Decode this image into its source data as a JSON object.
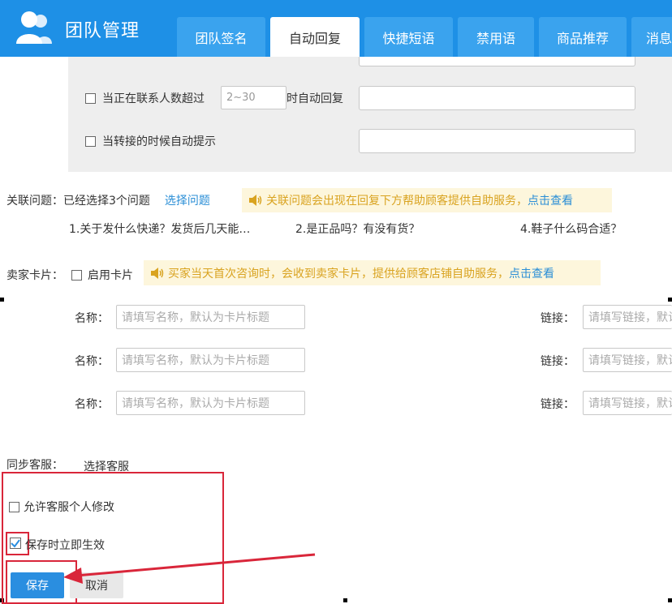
{
  "header": {
    "title": "团队管理",
    "tabs": [
      {
        "label": "团队签名",
        "active": false
      },
      {
        "label": "自动回复",
        "active": true
      },
      {
        "label": "快捷短语",
        "active": false
      },
      {
        "label": "禁用语",
        "active": false
      },
      {
        "label": "商品推荐",
        "active": false
      },
      {
        "label": "消息",
        "active": false
      }
    ]
  },
  "auto_reply": {
    "contacts_label": "当正在联系人数超过",
    "contacts_placeholder": "2~30",
    "contacts_suffix": "时自动回复",
    "transfer_label": "当转接的时候自动提示"
  },
  "related": {
    "label": "关联问题：",
    "selected": "已经选择3个问题",
    "select_link": "选择问题",
    "notice": "关联问题会出现在回复下方帮助顾客提供自助服务，",
    "notice_link": "点击查看",
    "questions": [
      "1.关于发什么快递？发货后几天能…",
      "2.是正品吗？有没有货？",
      "4.鞋子什么码合适？"
    ]
  },
  "seller_card": {
    "label": "卖家卡片：",
    "enable": "启用卡片",
    "notice": "买家当天首次咨询时，会收到卖家卡片，提供给顾客店铺自助服务，",
    "notice_link": "点击查看",
    "name_label": "名称：",
    "name_placeholder": "请填写名称，默认为卡片标题",
    "link_label": "链接：",
    "link_placeholder": "请填写链接，默认"
  },
  "sync": {
    "label": "同步客服：",
    "select_link": "选择客服",
    "allow_edit": "允许客服个人修改",
    "effective": "保存时立即生效",
    "effective_checked": true
  },
  "actions": {
    "save": "保存",
    "cancel": "取消"
  },
  "colors": {
    "header": "#1e90e6",
    "annotation_red": "#d9263a",
    "link": "#2a8ed6",
    "notice_text": "#d9a320"
  }
}
